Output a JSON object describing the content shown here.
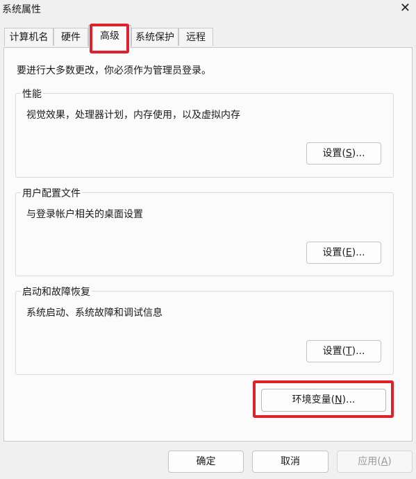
{
  "window": {
    "title": "系统属性",
    "close_glyph": "✕"
  },
  "tabs": [
    {
      "label": "计算机名",
      "active": false
    },
    {
      "label": "硬件",
      "active": false
    },
    {
      "label": "高级",
      "active": true
    },
    {
      "label": "系统保护",
      "active": false
    },
    {
      "label": "远程",
      "active": false
    }
  ],
  "admin_note": "要进行大多数更改，你必须作为管理员登录。",
  "performance": {
    "legend": "性能",
    "desc": "视觉效果，处理器计划，内存使用，以及虚拟内存",
    "btn_prefix": "设置(",
    "btn_key": "S",
    "btn_suffix": ")..."
  },
  "user_profiles": {
    "legend": "用户配置文件",
    "desc": "与登录帐户相关的桌面设置",
    "btn_prefix": "设置(",
    "btn_key": "E",
    "btn_suffix": ")..."
  },
  "startup_recovery": {
    "legend": "启动和故障恢复",
    "desc": "系统启动、系统故障和调试信息",
    "btn_prefix": "设置(",
    "btn_key": "T",
    "btn_suffix": ")..."
  },
  "env_vars": {
    "prefix": "环境变量(",
    "key": "N",
    "suffix": ")..."
  },
  "footer": {
    "ok": "确定",
    "cancel": "取消",
    "apply_prefix": "应用(",
    "apply_key": "A",
    "apply_suffix": ")"
  },
  "colors": {
    "highlight": "#e0202a"
  }
}
